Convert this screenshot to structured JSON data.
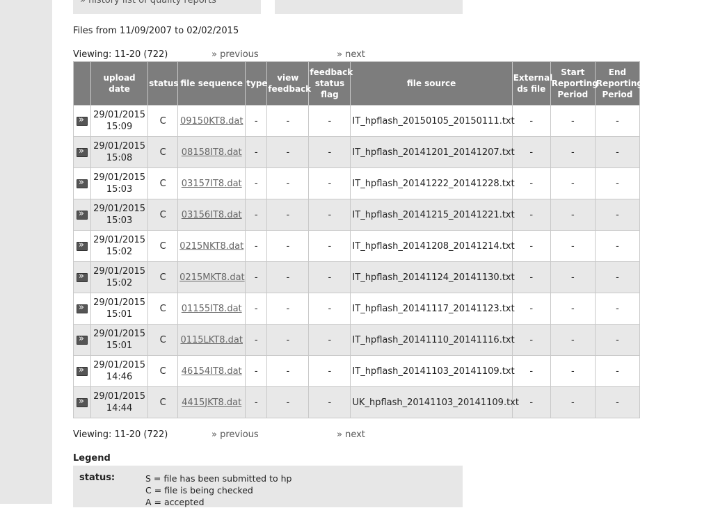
{
  "top": {
    "history_link": "» history list of quality reports"
  },
  "files_range": "Files from 11/09/2007 to 02/02/2015",
  "pager": {
    "viewing": "Viewing: 11-20 (722)",
    "previous": "» previous",
    "next": "» next"
  },
  "table": {
    "headers": [
      "",
      "upload date",
      "status",
      "file sequence",
      "type",
      "view feedback",
      "feedback status flag",
      "file source",
      "External ds file",
      "Start Reporting Period",
      "End Reporting Period"
    ],
    "rows": [
      {
        "date": "29/01/2015",
        "time": "15:09",
        "status": "C",
        "sequence": "09150KT8.dat",
        "type": "-",
        "view_feedback": "-",
        "flag": "-",
        "source": "IT_hpflash_20150105_20150111.txt",
        "external": "-",
        "start": "-",
        "end": "-"
      },
      {
        "date": "29/01/2015",
        "time": "15:08",
        "status": "C",
        "sequence": "08158IT8.dat",
        "type": "-",
        "view_feedback": "-",
        "flag": "-",
        "source": "IT_hpflash_20141201_20141207.txt",
        "external": "-",
        "start": "-",
        "end": "-"
      },
      {
        "date": "29/01/2015",
        "time": "15:03",
        "status": "C",
        "sequence": "03157IT8.dat",
        "type": "-",
        "view_feedback": "-",
        "flag": "-",
        "source": "IT_hpflash_20141222_20141228.txt",
        "external": "-",
        "start": "-",
        "end": "-"
      },
      {
        "date": "29/01/2015",
        "time": "15:03",
        "status": "C",
        "sequence": "03156IT8.dat",
        "type": "-",
        "view_feedback": "-",
        "flag": "-",
        "source": "IT_hpflash_20141215_20141221.txt",
        "external": "-",
        "start": "-",
        "end": "-"
      },
      {
        "date": "29/01/2015",
        "time": "15:02",
        "status": "C",
        "sequence": "0215NKT8.dat",
        "type": "-",
        "view_feedback": "-",
        "flag": "-",
        "source": "IT_hpflash_20141208_20141214.txt",
        "external": "-",
        "start": "-",
        "end": "-"
      },
      {
        "date": "29/01/2015",
        "time": "15:02",
        "status": "C",
        "sequence": "0215MKT8.dat",
        "type": "-",
        "view_feedback": "-",
        "flag": "-",
        "source": "IT_hpflash_20141124_20141130.txt",
        "external": "-",
        "start": "-",
        "end": "-"
      },
      {
        "date": "29/01/2015",
        "time": "15:01",
        "status": "C",
        "sequence": "01155IT8.dat",
        "type": "-",
        "view_feedback": "-",
        "flag": "-",
        "source": "IT_hpflash_20141117_20141123.txt",
        "external": "-",
        "start": "-",
        "end": "-"
      },
      {
        "date": "29/01/2015",
        "time": "15:01",
        "status": "C",
        "sequence": "0115LKT8.dat",
        "type": "-",
        "view_feedback": "-",
        "flag": "-",
        "source": "IT_hpflash_20141110_20141116.txt",
        "external": "-",
        "start": "-",
        "end": "-"
      },
      {
        "date": "29/01/2015",
        "time": "14:46",
        "status": "C",
        "sequence": "46154IT8.dat",
        "type": "-",
        "view_feedback": "-",
        "flag": "-",
        "source": "IT_hpflash_20141103_20141109.txt",
        "external": "-",
        "start": "-",
        "end": "-"
      },
      {
        "date": "29/01/2015",
        "time": "14:44",
        "status": "C",
        "sequence": "4415JKT8.dat",
        "type": "-",
        "view_feedback": "-",
        "flag": "-",
        "source": "UK_hpflash_20141103_20141109.txt",
        "external": "-",
        "start": "-",
        "end": "-"
      }
    ]
  },
  "legend": {
    "title": "Legend",
    "status_label": "status:",
    "status_lines": [
      "S = file has been submitted to hp",
      "C = file is being checked",
      "A = accepted"
    ]
  },
  "icons": {
    "row_icon": "details-arrow-icon"
  },
  "colors": {
    "header_bg": "#7d7d7d",
    "row_alt_bg": "#e8e8e8",
    "gutter_bg": "#e7e7e7"
  }
}
